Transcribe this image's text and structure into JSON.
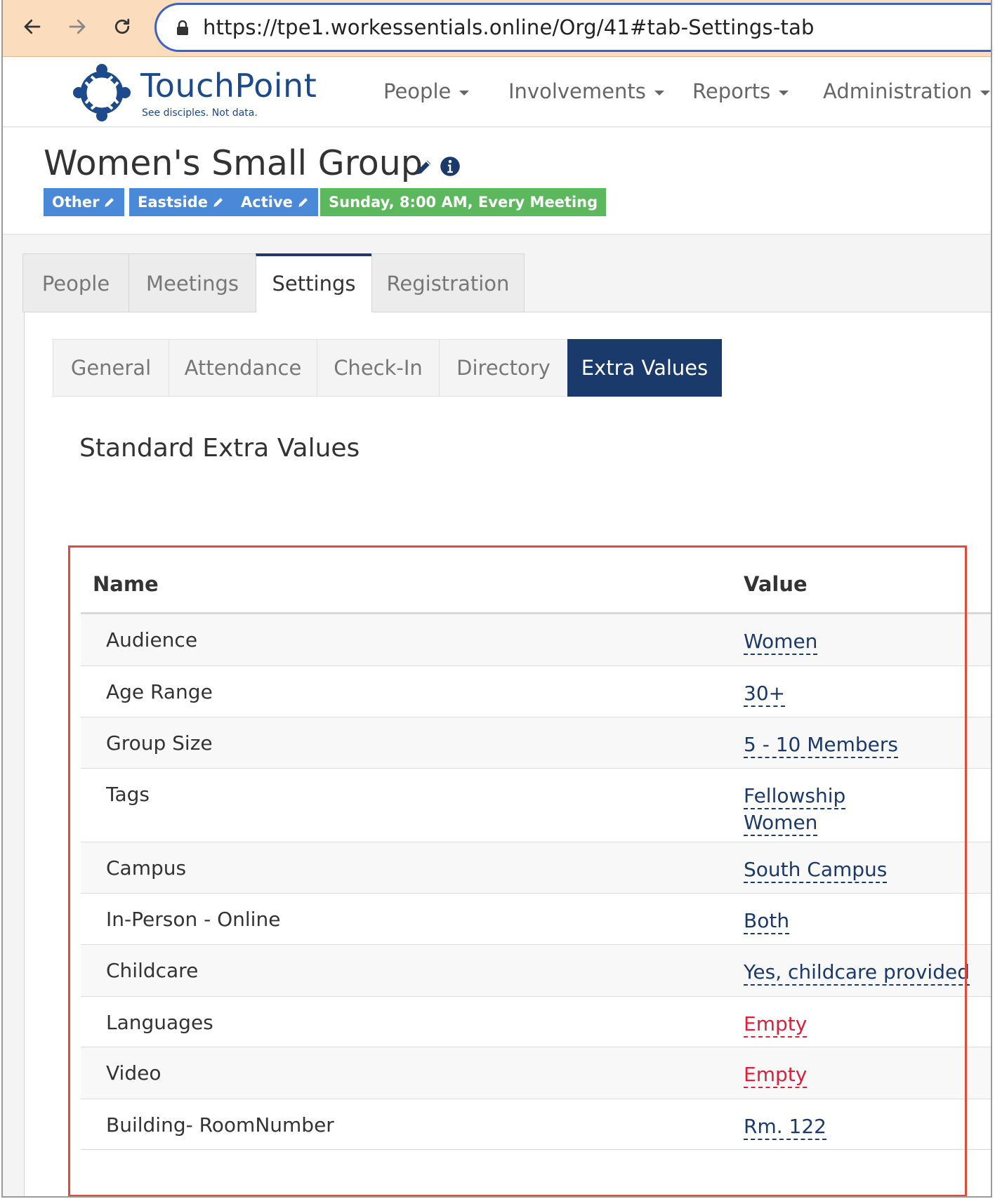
{
  "browser": {
    "url": "https://tpe1.workessentials.online/Org/41#tab-Settings-tab"
  },
  "header": {
    "logo_name": "TouchPoint",
    "logo_tagline": "See disciples. Not data.",
    "nav": [
      "People",
      "Involvements",
      "Reports",
      "Administration"
    ]
  },
  "org": {
    "title": "Women's Small Group",
    "badges": [
      "Other",
      "Eastside",
      "Active"
    ],
    "schedule": "Sunday, 8:00 AM, Every Meeting"
  },
  "tabs": [
    "People",
    "Meetings",
    "Settings",
    "Registration"
  ],
  "active_tab": "Settings",
  "subtabs": [
    "General",
    "Attendance",
    "Check-In",
    "Directory",
    "Extra Values"
  ],
  "active_subtab": "Extra Values",
  "section_title": "Standard Extra Values",
  "table": {
    "columns": [
      "Name",
      "Value"
    ],
    "rows": [
      {
        "name": "Audience",
        "values": [
          "Women"
        ]
      },
      {
        "name": "Age Range",
        "values": [
          "30+"
        ]
      },
      {
        "name": "Group Size",
        "values": [
          "5 - 10 Members"
        ]
      },
      {
        "name": "Tags",
        "values": [
          "Fellowship",
          "Women"
        ]
      },
      {
        "name": "Campus",
        "values": [
          "South Campus"
        ]
      },
      {
        "name": "In-Person - Online",
        "values": [
          "Both"
        ]
      },
      {
        "name": "Childcare",
        "values": [
          "Yes, childcare provided"
        ]
      },
      {
        "name": "Languages",
        "values": [
          "Empty"
        ],
        "empty": true
      },
      {
        "name": "Video",
        "values": [
          "Empty"
        ],
        "empty": true
      },
      {
        "name": "Building- RoomNumber",
        "values": [
          "Rm. 122"
        ]
      }
    ]
  },
  "colors": {
    "brand": "#1c4a8a",
    "active_tab": "#1a3a6c",
    "badge_blue": "#4a89d8",
    "badge_green": "#5cb85c",
    "empty_value": "#dd1f3a",
    "highlight": "#e04b3a"
  }
}
